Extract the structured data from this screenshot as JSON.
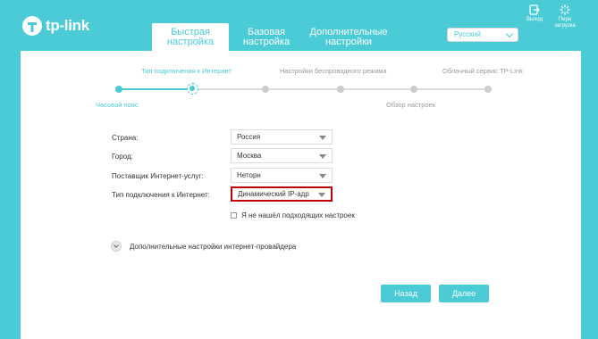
{
  "brand": {
    "logo_text": "tp-link"
  },
  "tabs": [
    {
      "label": "Быстрая настройка",
      "active": true
    },
    {
      "label": "Базовая настройка",
      "active": false
    },
    {
      "label": "Дополнительные настройки",
      "active": false
    }
  ],
  "language": {
    "selected": "Русский"
  },
  "header_buttons": {
    "logout": "Выход",
    "reboot": "Пере\nзагрузка"
  },
  "steps": {
    "top": [
      "Тип подключения к Интернет",
      "Настройки беспроводного режима",
      "Облачный сервис TP-Link"
    ],
    "bottom": [
      "Часовой пояс",
      "Обзор настроек"
    ],
    "current_index": 1,
    "total": 6
  },
  "form": {
    "country_label": "Страна:",
    "country_value": "Россия",
    "city_label": "Город:",
    "city_value": "Москва",
    "isp_label": "Поставщик Интернет-услуг:",
    "isp_value": "Неторн",
    "conn_label": "Тип подключения к Интернет:",
    "conn_value": "Динамический IP-адр",
    "checkbox_label": "Я не нашёл подходящих настроек"
  },
  "advanced_label": "Дополнительные настройки интернет-провайдера",
  "buttons": {
    "back": "Назад",
    "next": "Далее"
  },
  "colors": {
    "accent": "#4acbd6",
    "highlight": "#c00000"
  }
}
